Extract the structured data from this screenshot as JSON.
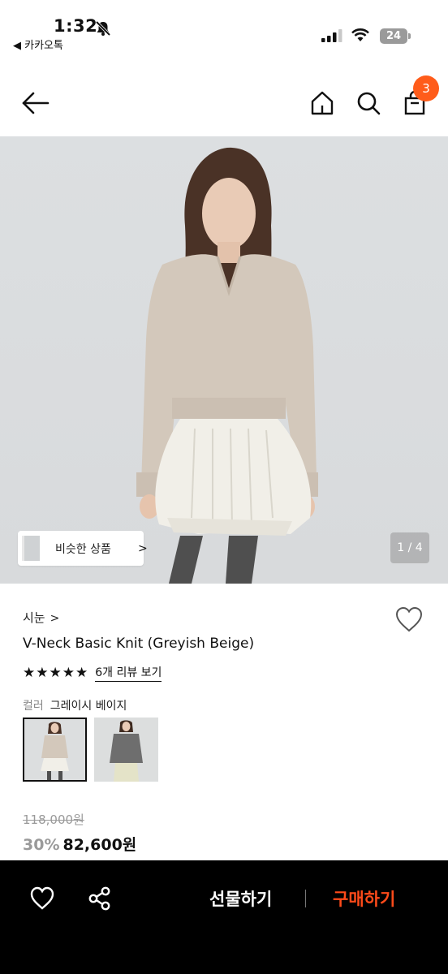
{
  "status_bar": {
    "time": "1:32",
    "back_app": "◀ 카카오톡",
    "battery": "24"
  },
  "header": {
    "cart_count": "3"
  },
  "hero": {
    "similar_label": "비슷한 상품",
    "similar_chevron": ">",
    "page_indicator": "1 / 4"
  },
  "product": {
    "brand": "시눈",
    "brand_chevron": ">",
    "name": "V-Neck Basic Knit (Greyish Beige)",
    "stars": "★★★★★",
    "review_link": "6개 리뷰 보기",
    "color_label": "컬러",
    "color_value": "그레이시 베이지",
    "original_price": "118,000원",
    "discount": "30%",
    "price": "82,600원"
  },
  "bottom_bar": {
    "gift_label": "선물하기",
    "buy_label": "구매하기"
  },
  "colors": {
    "accent": "#ff5c1a",
    "buy": "#ff4b1a",
    "bar": "#000000"
  },
  "icons": [
    "back-arrow-icon",
    "home-icon",
    "search-icon",
    "shopping-bag-icon",
    "heart-icon",
    "share-icon",
    "bell-off-icon",
    "signal-icon",
    "wifi-icon"
  ]
}
